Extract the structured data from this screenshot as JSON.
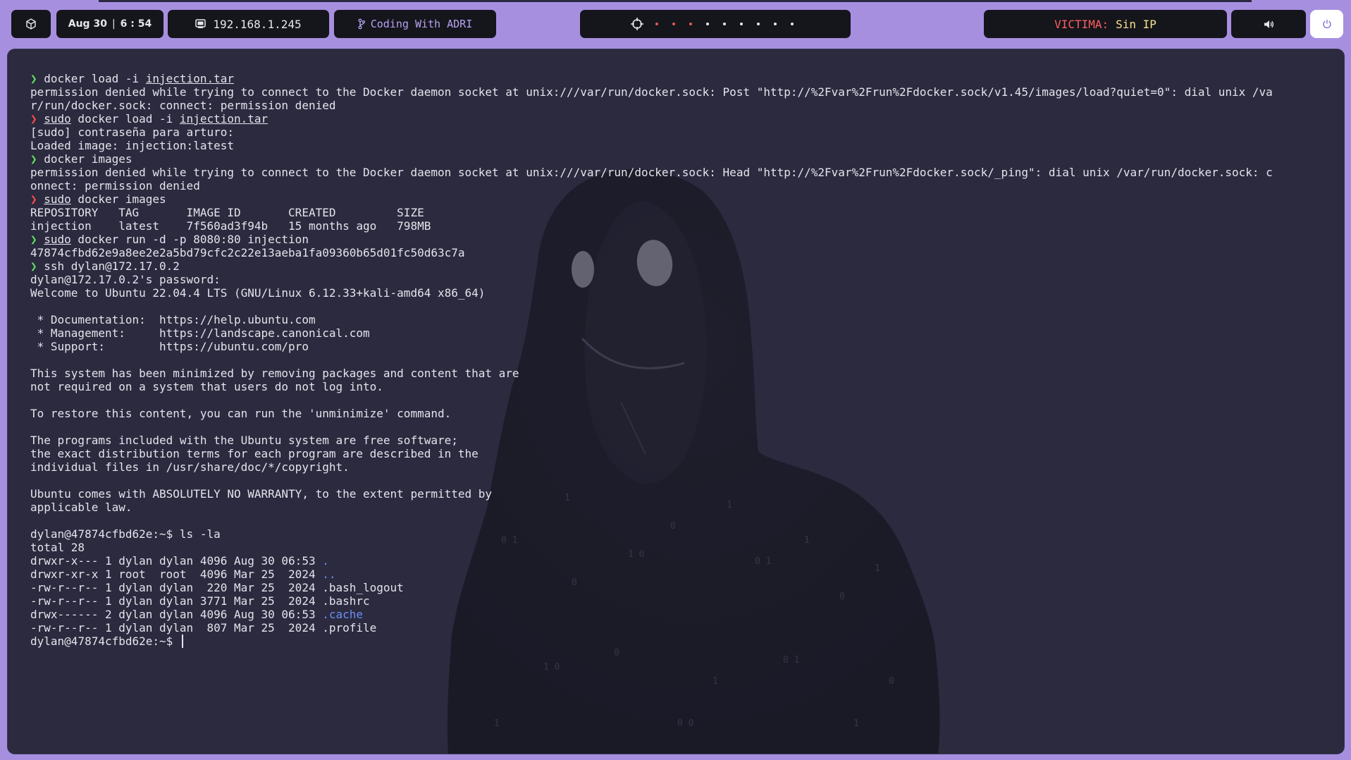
{
  "topbar": {
    "date": "Aug 30",
    "time": "6 : 54",
    "separator": "|",
    "ip": "192.168.1.245",
    "project": "Coding With ADRI",
    "target_label": "VICTIMA:",
    "target_value": "Sin IP",
    "workspaces": {
      "count": 9,
      "active_indices": [
        0,
        1,
        2
      ],
      "active_color": "#e05a5a"
    }
  },
  "terminal": {
    "lines": [
      {
        "parts": [
          {
            "t": "❯ ",
            "c": "ok"
          },
          {
            "t": "docker load -i "
          },
          {
            "t": "injection.tar",
            "c": "cmd-u"
          }
        ]
      },
      {
        "parts": [
          {
            "t": "permission denied while trying to connect to the Docker daemon socket at unix:///var/run/docker.sock: Post \"http://%2Fvar%2Frun%2Fdocker.sock/v1.45/images/load?quiet=0\": dial unix /va"
          }
        ]
      },
      {
        "parts": [
          {
            "t": "r/run/docker.sock: connect: permission denied"
          }
        ]
      },
      {
        "parts": [
          {
            "t": "❯ ",
            "c": "err"
          },
          {
            "t": "sudo",
            "c": "cmd-u"
          },
          {
            "t": " docker load -i "
          },
          {
            "t": "injection.tar",
            "c": "cmd-u"
          }
        ]
      },
      {
        "parts": [
          {
            "t": "[sudo] contraseña para arturo:"
          }
        ]
      },
      {
        "parts": [
          {
            "t": "Loaded image: injection:latest"
          }
        ]
      },
      {
        "parts": [
          {
            "t": "❯ ",
            "c": "ok"
          },
          {
            "t": "docker images"
          }
        ]
      },
      {
        "parts": [
          {
            "t": "permission denied while trying to connect to the Docker daemon socket at unix:///var/run/docker.sock: Head \"http://%2Fvar%2Frun%2Fdocker.sock/_ping\": dial unix /var/run/docker.sock: c"
          }
        ]
      },
      {
        "parts": [
          {
            "t": "onnect: permission denied"
          }
        ]
      },
      {
        "parts": [
          {
            "t": "❯ ",
            "c": "err"
          },
          {
            "t": "sudo",
            "c": "cmd-u"
          },
          {
            "t": " docker images"
          }
        ]
      },
      {
        "parts": [
          {
            "t": "REPOSITORY   TAG       IMAGE ID       CREATED         SIZE"
          }
        ]
      },
      {
        "parts": [
          {
            "t": "injection    latest    7f560ad3f94b   15 months ago   798MB"
          }
        ]
      },
      {
        "parts": [
          {
            "t": "❯ ",
            "c": "ok"
          },
          {
            "t": "sudo",
            "c": "cmd-u"
          },
          {
            "t": " docker run -d -p 8080:80 injection"
          }
        ]
      },
      {
        "parts": [
          {
            "t": "47874cfbd62e9a8ee2e2a5bd79cfc2c22e13aeba1fa09360b65d01fc50d63c7a"
          }
        ]
      },
      {
        "parts": [
          {
            "t": "❯ ",
            "c": "ok"
          },
          {
            "t": "ssh dylan@172.17.0.2"
          }
        ]
      },
      {
        "parts": [
          {
            "t": "dylan@172.17.0.2's password:"
          }
        ]
      },
      {
        "parts": [
          {
            "t": "Welcome to Ubuntu 22.04.4 LTS (GNU/Linux 6.12.33+kali-amd64 x86_64)"
          }
        ]
      },
      {
        "parts": [
          {
            "t": ""
          }
        ]
      },
      {
        "parts": [
          {
            "t": " * Documentation:  https://help.ubuntu.com"
          }
        ]
      },
      {
        "parts": [
          {
            "t": " * Management:     https://landscape.canonical.com"
          }
        ]
      },
      {
        "parts": [
          {
            "t": " * Support:        https://ubuntu.com/pro"
          }
        ]
      },
      {
        "parts": [
          {
            "t": ""
          }
        ]
      },
      {
        "parts": [
          {
            "t": "This system has been minimized by removing packages and content that are"
          }
        ]
      },
      {
        "parts": [
          {
            "t": "not required on a system that users do not log into."
          }
        ]
      },
      {
        "parts": [
          {
            "t": ""
          }
        ]
      },
      {
        "parts": [
          {
            "t": "To restore this content, you can run the 'unminimize' command."
          }
        ]
      },
      {
        "parts": [
          {
            "t": ""
          }
        ]
      },
      {
        "parts": [
          {
            "t": "The programs included with the Ubuntu system are free software;"
          }
        ]
      },
      {
        "parts": [
          {
            "t": "the exact distribution terms for each program are described in the"
          }
        ]
      },
      {
        "parts": [
          {
            "t": "individual files in /usr/share/doc/*/copyright."
          }
        ]
      },
      {
        "parts": [
          {
            "t": ""
          }
        ]
      },
      {
        "parts": [
          {
            "t": "Ubuntu comes with ABSOLUTELY NO WARRANTY, to the extent permitted by"
          }
        ]
      },
      {
        "parts": [
          {
            "t": "applicable law."
          }
        ]
      },
      {
        "parts": [
          {
            "t": ""
          }
        ]
      },
      {
        "parts": [
          {
            "t": "dylan@47874cfbd62e:~$ ls -la"
          }
        ]
      },
      {
        "parts": [
          {
            "t": "total 28"
          }
        ]
      },
      {
        "parts": [
          {
            "t": "drwxr-x--- 1 dylan dylan 4096 Aug 30 06:53 "
          },
          {
            "t": ".",
            "c": "dir"
          }
        ]
      },
      {
        "parts": [
          {
            "t": "drwxr-xr-x 1 root  root  4096 Mar 25  2024 "
          },
          {
            "t": "..",
            "c": "dir"
          }
        ]
      },
      {
        "parts": [
          {
            "t": "-rw-r--r-- 1 dylan dylan  220 Mar 25  2024 .bash_logout"
          }
        ]
      },
      {
        "parts": [
          {
            "t": "-rw-r--r-- 1 dylan dylan 3771 Mar 25  2024 .bashrc"
          }
        ]
      },
      {
        "parts": [
          {
            "t": "drwx------ 2 dylan dylan 4096 Aug 30 06:53 "
          },
          {
            "t": ".cache",
            "c": "dir"
          }
        ]
      },
      {
        "parts": [
          {
            "t": "-rw-r--r-- 1 dylan dylan  807 Mar 25  2024 .profile"
          }
        ]
      }
    ],
    "prompt": "dylan@47874cfbd62e:~$ "
  },
  "colors": {
    "background": "#a78fe0",
    "pill": "#15151c",
    "terminal_bg": "#2b2a3f",
    "prompt_ok": "#5ee05e",
    "prompt_err": "#ff4b4b",
    "directory": "#6d8ff5",
    "target_label": "#ff5f5f",
    "target_value": "#f5e38a"
  }
}
